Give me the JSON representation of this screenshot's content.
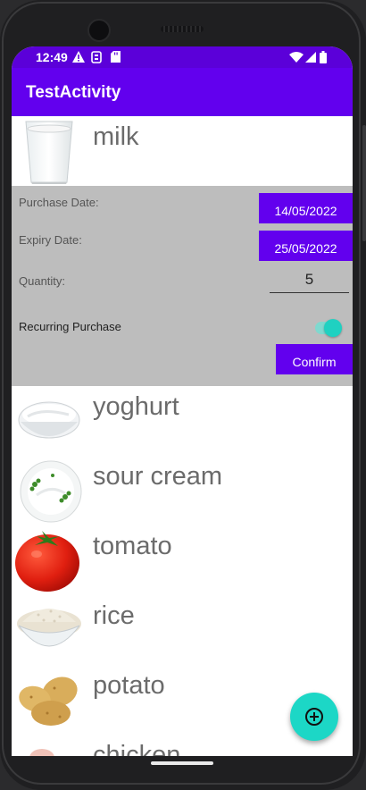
{
  "status_bar": {
    "time": "12:49"
  },
  "app_bar": {
    "title": "TestActivity"
  },
  "items": [
    {
      "name": "milk"
    },
    {
      "name": "yoghurt"
    },
    {
      "name": "sour cream"
    },
    {
      "name": "tomato"
    },
    {
      "name": "rice"
    },
    {
      "name": "potato"
    },
    {
      "name": "chicken"
    }
  ],
  "detail_panel": {
    "purchase_date_label": "Purchase Date:",
    "purchase_date_value": "14/05/2022",
    "expiry_date_label": "Expiry Date:",
    "expiry_date_value": "25/05/2022",
    "quantity_label": "Quantity:",
    "quantity_value": "5",
    "recurring_label": "Recurring Purchase",
    "recurring_enabled": true,
    "confirm_label": "Confirm"
  },
  "fab": {
    "icon": "add-circle-icon"
  },
  "colors": {
    "primary": "#6200ee",
    "status": "#5b00d9",
    "accent": "#1cd7c6",
    "panel": "#bdbdbd"
  }
}
